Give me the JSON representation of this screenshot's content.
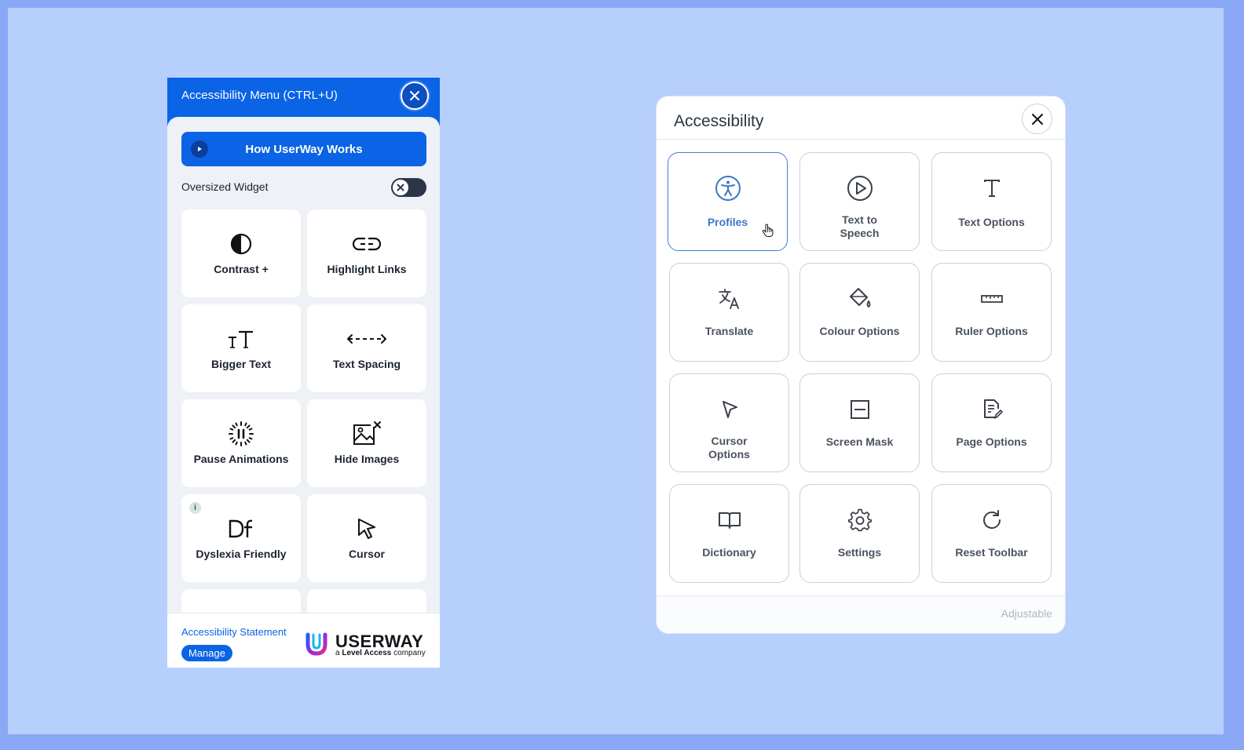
{
  "userway_menu": {
    "title": "Accessibility Menu (CTRL+U)",
    "close_icon": "close-icon",
    "how_button": "How UserWay Works",
    "oversized_widget": {
      "label": "Oversized Widget",
      "enabled": false
    },
    "tiles": [
      {
        "label": "Contrast +",
        "icon": "contrast-icon"
      },
      {
        "label": "Highlight Links",
        "icon": "link-icon"
      },
      {
        "label": "Bigger Text",
        "icon": "text-size-icon"
      },
      {
        "label": "Text Spacing",
        "icon": "text-spacing-icon"
      },
      {
        "label": "Pause Animations",
        "icon": "pause-animation-icon"
      },
      {
        "label": "Hide Images",
        "icon": "hide-image-icon"
      },
      {
        "label": "Dyslexia Friendly",
        "icon": "dyslexia-icon",
        "info_badge": "i"
      },
      {
        "label": "Cursor",
        "icon": "cursor-icon"
      }
    ],
    "footer": {
      "statement_link": "Accessibility Statement",
      "manage_button": "Manage",
      "logo_word": "USERWAY",
      "logo_sub_prefix": "a",
      "logo_sub_brand": "Level Access",
      "logo_sub_suffix": "company"
    },
    "colors": {
      "brand": "#0b63e5",
      "panel_bg": "#eef1f6"
    }
  },
  "accessibility_panel": {
    "title": "Accessibility",
    "tiles": [
      {
        "label": "Profiles",
        "icon": "accessibility-person-icon",
        "active": true
      },
      {
        "label": "Text to Speech",
        "icon": "play-circle-icon",
        "active": false
      },
      {
        "label": "Text Options",
        "icon": "text-t-icon",
        "active": false
      },
      {
        "label": "Translate",
        "icon": "translate-icon",
        "active": false
      },
      {
        "label": "Colour Options",
        "icon": "paint-bucket-icon",
        "active": false
      },
      {
        "label": "Ruler Options",
        "icon": "ruler-icon",
        "active": false
      },
      {
        "label": "Cursor Options",
        "icon": "pointer-icon",
        "active": false
      },
      {
        "label": "Screen Mask",
        "icon": "screen-mask-icon",
        "active": false
      },
      {
        "label": "Page Options",
        "icon": "page-edit-icon",
        "active": false
      },
      {
        "label": "Dictionary",
        "icon": "book-icon",
        "active": false
      },
      {
        "label": "Settings",
        "icon": "gear-icon",
        "active": false
      },
      {
        "label": "Reset Toolbar",
        "icon": "reset-icon",
        "active": false
      }
    ],
    "footer_text": "Adjustable",
    "colors": {
      "accent": "#3b78c7",
      "border": "#c9d0da"
    }
  },
  "page": {
    "background": "#b6cffd",
    "frame": "#8aa8f5"
  }
}
